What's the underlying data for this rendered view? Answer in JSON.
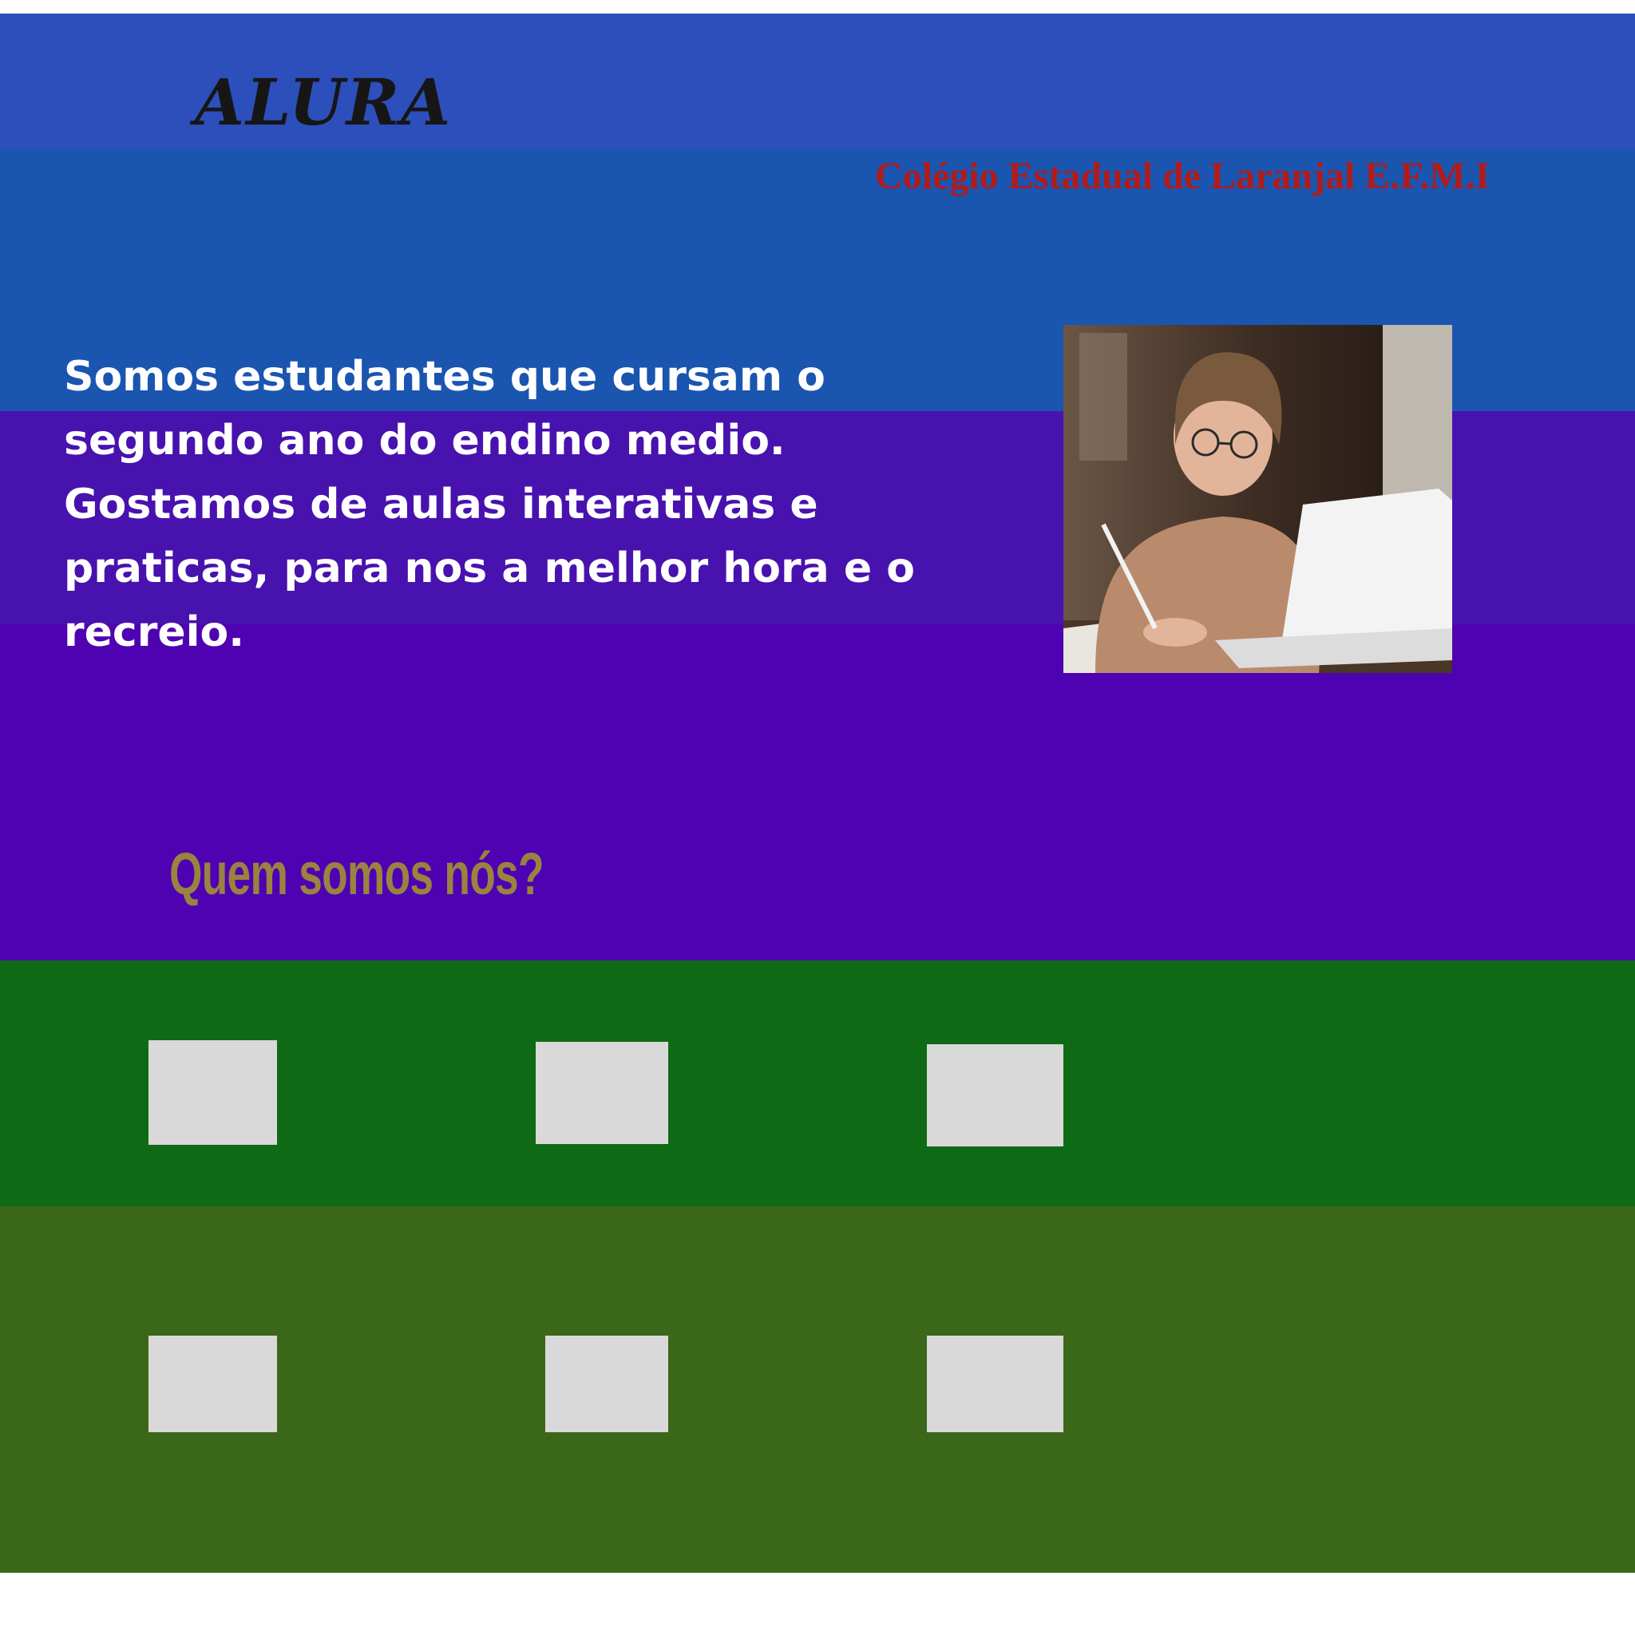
{
  "header": {
    "logo_text": "ALURA",
    "school_name": "Colégio Estadual de Laranjal E.F.M.I"
  },
  "intro": {
    "text": "Somos estudantes que cursam o segundo ano do endino medio.  Gostamos de aulas interativas e praticas, para nos a melhor hora e o recreio."
  },
  "section": {
    "heading": "Quem somos nós?"
  },
  "colors": {
    "band_top": "#2d4fbc",
    "band_blue": "#1a55b0",
    "band_indigo": "#4812ae",
    "band_purple": "#4f02b1",
    "band_green": "#0f6a15",
    "band_olive": "#3b6718",
    "school_name": "#b01c1c",
    "heading": "#9a8240",
    "placeholder": "#d9d9d9"
  },
  "icons": {
    "photo": "student-studying-photo"
  }
}
